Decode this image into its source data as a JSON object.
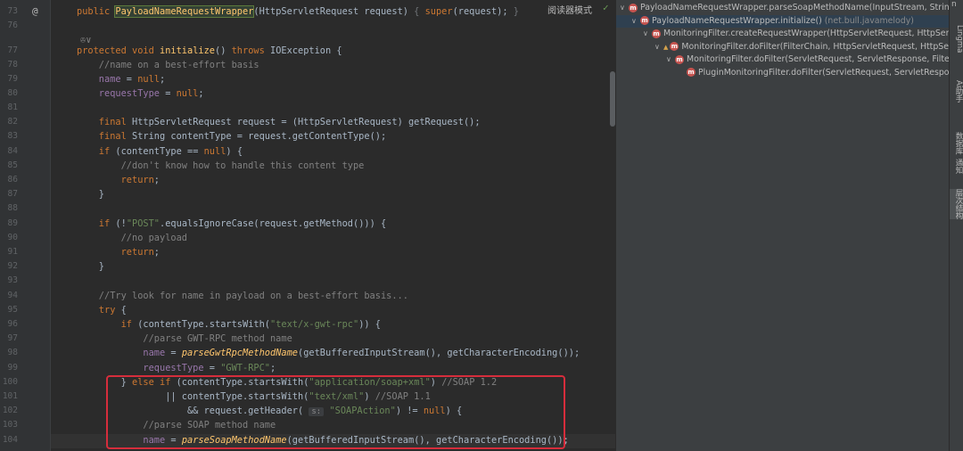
{
  "editor": {
    "reader_mode_label": "阅读器模式",
    "annotation_marker": "@",
    "lines": [
      {
        "n": "73",
        "parts": [
          [
            "kw",
            "public "
          ],
          [
            "hl",
            "PayloadNameRequestWrapper"
          ],
          [
            "",
            "(HttpServletRequest request) "
          ],
          [
            "dim",
            "{ "
          ],
          [
            "kw",
            "super"
          ],
          [
            "",
            "(request); "
          ],
          [
            "dim",
            "}"
          ]
        ]
      },
      {
        "n": "76",
        "parts": []
      },
      {
        "n": "",
        "parts": [
          [
            "cm",
            "✇∨"
          ]
        ]
      },
      {
        "n": "77",
        "parts": [
          [
            "kw",
            "protected void "
          ],
          [
            "fn",
            "initialize"
          ],
          [
            "",
            "() "
          ],
          [
            "kw",
            "throws "
          ],
          [
            "",
            "IOException {"
          ]
        ]
      },
      {
        "n": "78",
        "parts": [
          [
            "cm",
            "    //name on a best-effort basis"
          ]
        ]
      },
      {
        "n": "79",
        "parts": [
          [
            "fl",
            "    name"
          ],
          [
            "",
            " = "
          ],
          [
            "kw",
            "null"
          ],
          [
            "",
            ";"
          ]
        ]
      },
      {
        "n": "80",
        "parts": [
          [
            "fl",
            "    requestType"
          ],
          [
            "",
            " = "
          ],
          [
            "kw",
            "null"
          ],
          [
            "",
            ";"
          ]
        ]
      },
      {
        "n": "81",
        "parts": []
      },
      {
        "n": "82",
        "parts": [
          [
            "kw",
            "    final "
          ],
          [
            "",
            "HttpServletRequest request = (HttpServletRequest) getRequest();"
          ]
        ]
      },
      {
        "n": "83",
        "parts": [
          [
            "kw",
            "    final "
          ],
          [
            "",
            "String contentType = request.getContentType();"
          ]
        ]
      },
      {
        "n": "84",
        "parts": [
          [
            "kw",
            "    if "
          ],
          [
            "",
            "(contentType == "
          ],
          [
            "kw",
            "null"
          ],
          [
            "",
            ") {"
          ]
        ]
      },
      {
        "n": "85",
        "parts": [
          [
            "cm",
            "        //don't know how to handle this content type"
          ]
        ]
      },
      {
        "n": "86",
        "parts": [
          [
            "kw",
            "        return"
          ],
          [
            "",
            ";"
          ]
        ]
      },
      {
        "n": "87",
        "parts": [
          [
            "",
            "    }"
          ]
        ]
      },
      {
        "n": "88",
        "parts": []
      },
      {
        "n": "89",
        "parts": [
          [
            "kw",
            "    if "
          ],
          [
            "",
            "(!"
          ],
          [
            "st",
            "\"POST\""
          ],
          [
            "",
            ".equalsIgnoreCase(request.getMethod())) {"
          ]
        ]
      },
      {
        "n": "90",
        "parts": [
          [
            "cm",
            "        //no payload"
          ]
        ]
      },
      {
        "n": "91",
        "parts": [
          [
            "kw",
            "        return"
          ],
          [
            "",
            ";"
          ]
        ]
      },
      {
        "n": "92",
        "parts": [
          [
            "",
            "    }"
          ]
        ]
      },
      {
        "n": "93",
        "parts": []
      },
      {
        "n": "94",
        "parts": [
          [
            "cm",
            "    //Try look for name in payload on a best-effort basis..."
          ]
        ]
      },
      {
        "n": "95",
        "parts": [
          [
            "kw",
            "    try "
          ],
          [
            "",
            "{"
          ]
        ]
      },
      {
        "n": "96",
        "parts": [
          [
            "kw",
            "        if "
          ],
          [
            "",
            "(contentType.startsWith("
          ],
          [
            "st",
            "\"text/x-gwt-rpc\""
          ],
          [
            "",
            ")) {"
          ]
        ]
      },
      {
        "n": "97",
        "parts": [
          [
            "cm",
            "            //parse GWT-RPC method name"
          ]
        ]
      },
      {
        "n": "98",
        "parts": [
          [
            "fl",
            "            name"
          ],
          [
            "",
            " = "
          ],
          [
            "it",
            "parseGwtRpcMethodName"
          ],
          [
            "",
            "(getBufferedInputStream(), getCharacterEncoding());"
          ]
        ]
      },
      {
        "n": "99",
        "parts": [
          [
            "fl",
            "            requestType"
          ],
          [
            "",
            " = "
          ],
          [
            "st",
            "\"GWT-RPC\""
          ],
          [
            "",
            ";"
          ]
        ]
      },
      {
        "n": "100",
        "parts": [
          [
            "",
            "        } "
          ],
          [
            "kw",
            "else if "
          ],
          [
            "",
            "(contentType.startsWith("
          ],
          [
            "st",
            "\"application/soap+xml\""
          ],
          [
            "",
            ") "
          ],
          [
            "cm",
            "//SOAP 1.2"
          ]
        ]
      },
      {
        "n": "101",
        "parts": [
          [
            "",
            "                || contentType.startsWith("
          ],
          [
            "st",
            "\"text/xml\""
          ],
          [
            "",
            ") "
          ],
          [
            "cm",
            "//SOAP 1.1"
          ]
        ]
      },
      {
        "n": "102",
        "parts": [
          [
            "",
            "                    && request.getHeader( "
          ],
          [
            "hint",
            "s:"
          ],
          [
            "st",
            " \"SOAPAction\""
          ],
          [
            "",
            ") != "
          ],
          [
            "kw",
            "null"
          ],
          [
            "",
            ") {"
          ]
        ]
      },
      {
        "n": "103",
        "parts": [
          [
            "cm",
            "            //parse SOAP method name"
          ]
        ]
      },
      {
        "n": "104",
        "parts": [
          [
            "fl",
            "            name"
          ],
          [
            "",
            " = "
          ],
          [
            "it",
            "parseSoapMethodName"
          ],
          [
            "",
            "(getBufferedInputStream(), getCharacterEncoding());"
          ]
        ]
      }
    ]
  },
  "call_hierarchy": {
    "rows": [
      {
        "indent": 0,
        "arrow": "∨",
        "locked": false,
        "text": "PayloadNameRequestWrapper.parseSoapMethodName(InputStream, String",
        "pkg": "",
        "selected": false
      },
      {
        "indent": 1,
        "arrow": "∨",
        "locked": false,
        "text": "PayloadNameRequestWrapper.initialize()",
        "pkg": "(net.bull.javamelody)",
        "selected": true
      },
      {
        "indent": 2,
        "arrow": "∨",
        "locked": false,
        "text": "MonitoringFilter.createRequestWrapper(HttpServletRequest, HttpServle",
        "pkg": "",
        "selected": false
      },
      {
        "indent": 3,
        "arrow": "∨",
        "locked": true,
        "text": "MonitoringFilter.doFilter(FilterChain, HttpServletRequest, HttpServle",
        "pkg": "",
        "selected": false
      },
      {
        "indent": 4,
        "arrow": "∨",
        "locked": false,
        "text": "MonitoringFilter.doFilter(ServletRequest, ServletResponse, FilterC",
        "pkg": "",
        "selected": false
      },
      {
        "indent": 5,
        "arrow": "",
        "locked": false,
        "text": "PluginMonitoringFilter.doFilter(ServletRequest, ServletRespon",
        "pkg": "",
        "selected": false
      }
    ]
  },
  "right_sidebar": {
    "tabs": [
      {
        "label": "Lingma",
        "active": false
      },
      {
        "label": "Ai助手",
        "active": false
      },
      {
        "label": "数据库",
        "active": false
      },
      {
        "label": "通知",
        "active": false
      },
      {
        "label": "层次结构",
        "active": true
      }
    ],
    "top_letter": "n"
  }
}
